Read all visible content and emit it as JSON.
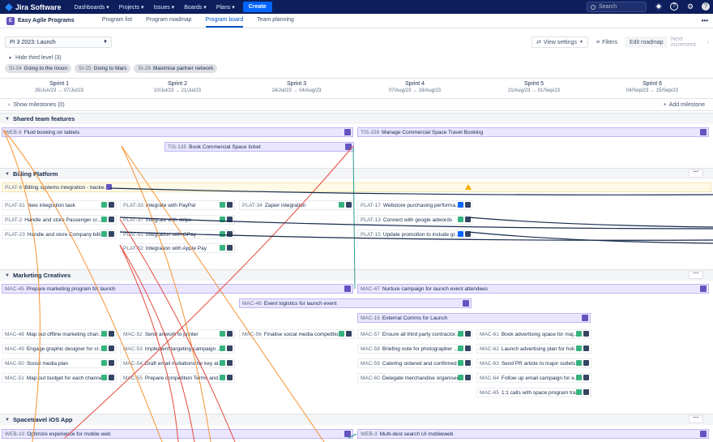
{
  "topbar": {
    "brand": "Jira Software",
    "nav": [
      "Dashboards ▾",
      "Projects ▾",
      "Issues ▾",
      "Boards ▾",
      "Plans ▾"
    ],
    "create": "Create",
    "search_placeholder": "Search",
    "avatar_glyph": "?"
  },
  "subnav": {
    "project_name": "Easy Agile Programs",
    "project_initial": "E",
    "tabs": [
      "Program list",
      "Program roadmap",
      "Program board",
      "Team planning"
    ],
    "active_tab": "Program board",
    "more": "•••"
  },
  "toolbar": {
    "pi": "PI 3 2023: Launch",
    "view_settings": "View settings",
    "filters": "Filters",
    "edit_roadmap": "Edit roadmap",
    "next_increment": "Next increment"
  },
  "third_level": "Hide third level (3)",
  "chips": [
    {
      "key": "SI-24",
      "name": "Going to the moon"
    },
    {
      "key": "SI-25",
      "name": "Going to Mars"
    },
    {
      "key": "SI-26",
      "name": "Maximise partner network"
    }
  ],
  "sprints": [
    {
      "name": "Sprint 1",
      "dates": "26/Jun/23 → 07/Jul/23"
    },
    {
      "name": "Sprint 2",
      "dates": "10/Jul/23 → 21/Jul/23"
    },
    {
      "name": "Sprint 3",
      "dates": "24/Jul/23 → 04/Aug/23"
    },
    {
      "name": "Sprint 4",
      "dates": "07/Aug/23 → 18/Aug/23"
    },
    {
      "name": "Sprint 5",
      "dates": "21/Aug/23 → 01/Sep/23"
    },
    {
      "name": "Sprint 6",
      "dates": "04/Sep/23 → 15/Sep/23"
    }
  ],
  "milestones": {
    "show": "Show milestones (0)",
    "add": "Add milestone"
  },
  "teams": [
    {
      "name": "Shared team features"
    },
    {
      "name": "Billing Platform"
    },
    {
      "name": "Marketing Creatives"
    },
    {
      "name": "Spacetravel iOS App"
    }
  ],
  "features": [
    {
      "key": "WEB-9",
      "title": "Fluid booking on tablets"
    },
    {
      "key": "TIS-159",
      "title": "Manage Commercial Space Travel Booking"
    },
    {
      "key": "TIS-135",
      "title": "Book Commercial Space ticket"
    },
    {
      "key": "PLAT-6",
      "title": "Billing systems integration - backe..."
    },
    {
      "key": "MAC-45",
      "title": "Prepare marketing program for launch"
    },
    {
      "key": "MAC-47",
      "title": "Nurture campaign for launch event attendees"
    },
    {
      "key": "MAC-46",
      "title": "Event logistics for launch event"
    },
    {
      "key": "MAC-16",
      "title": "External Comms for Launch"
    },
    {
      "key": "WEB-10",
      "title": "Optimize experience for mobile web"
    },
    {
      "key": "WEB-3",
      "title": "Multi-dest search UI mobileweb"
    }
  ],
  "issues": [
    {
      "key": "PLAT-51",
      "title": "New integration task"
    },
    {
      "key": "PLAT-2",
      "title": "Handle and store Passenger cr..."
    },
    {
      "key": "PLAT-23",
      "title": "Handle and store Company billi..."
    },
    {
      "key": "PLAT-33",
      "title": "Integrate with PayPal"
    },
    {
      "key": "PLAT-37",
      "title": "Integrate with stripe"
    },
    {
      "key": "PLAT-51",
      "title": "Integration with GPay"
    },
    {
      "key": "PLAT-52",
      "title": "Integration with Apple Pay"
    },
    {
      "key": "PLAT-34",
      "title": "Zapier integration"
    },
    {
      "key": "PLAT-17",
      "title": "Webstore purchasing performa..."
    },
    {
      "key": "PLAT-13",
      "title": "Connect with google adwords"
    },
    {
      "key": "PLAT-15",
      "title": "Update promotion to include gr..."
    },
    {
      "key": "MAC-48",
      "title": "Map out offline marketing chan..."
    },
    {
      "key": "MAC-49",
      "title": "Engage graphic designer for cr..."
    },
    {
      "key": "MAC-50",
      "title": "Social media plan"
    },
    {
      "key": "MAC-51",
      "title": "Map out budget for each channel"
    },
    {
      "key": "MAC-52",
      "title": "Send artwork to printer"
    },
    {
      "key": "MAC-53",
      "title": "Implement targeting campaign ..."
    },
    {
      "key": "MAC-54",
      "title": "Draft email invitations for key at..."
    },
    {
      "key": "MAC-55",
      "title": "Prepare competition Terms and..."
    },
    {
      "key": "MAC-56",
      "title": "Finalise social media competition"
    },
    {
      "key": "MAC-57",
      "title": "Ensure all third party contractor..."
    },
    {
      "key": "MAC-58",
      "title": "Briefing note for photographer ..."
    },
    {
      "key": "MAC-59",
      "title": "Catering ordered and confirmed"
    },
    {
      "key": "MAC-60",
      "title": "Delegate merchandise organised"
    },
    {
      "key": "MAC-61",
      "title": "Book advertising space for maj..."
    },
    {
      "key": "MAC-62",
      "title": "Launch advertising plan for holi..."
    },
    {
      "key": "MAC-63",
      "title": "Send PR article to major outlets"
    },
    {
      "key": "MAC-64",
      "title": "Follow up email campaign for e..."
    },
    {
      "key": "MAC-65",
      "title": "1:1 calls with space program tra..."
    }
  ],
  "colors": {
    "topbar": "#0c1e5b",
    "accent": "#0052cc",
    "epic": "#6554c0",
    "dep_red": "#e5493a",
    "dep_orange": "#f79232",
    "dep_teal": "#2a9d8f"
  }
}
